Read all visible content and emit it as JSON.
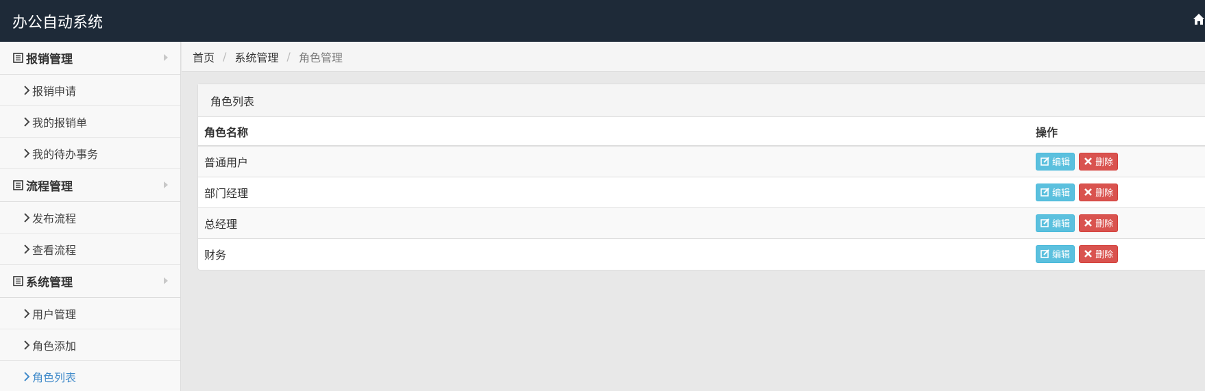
{
  "navbar": {
    "brand": "办公自动系统",
    "home_icon": "home-icon"
  },
  "sidebar": {
    "groups": [
      {
        "label": "报销管理",
        "icon": "list-icon",
        "items": [
          "报销申请",
          "我的报销单",
          "我的待办事务"
        ]
      },
      {
        "label": "流程管理",
        "icon": "list-icon",
        "items": [
          "发布流程",
          "查看流程"
        ]
      },
      {
        "label": "系统管理",
        "icon": "list-icon",
        "items": [
          "用户管理",
          "角色添加",
          "角色列表"
        ]
      }
    ],
    "active_item": "角色列表"
  },
  "breadcrumb": {
    "items": [
      "首页",
      "系统管理",
      "角色管理"
    ],
    "separator": "/"
  },
  "panel": {
    "title": "角色列表",
    "columns": [
      "角色名称",
      "操作"
    ],
    "rows": [
      {
        "name": "普通用户"
      },
      {
        "name": "部门经理"
      },
      {
        "name": "总经理"
      },
      {
        "name": "财务"
      }
    ],
    "edit_label": "编辑",
    "delete_label": "删除"
  },
  "colors": {
    "navbar_bg": "#1e2a38",
    "active_link": "#428bca",
    "edit_button": "#5bc0de",
    "delete_button": "#d9534f"
  }
}
